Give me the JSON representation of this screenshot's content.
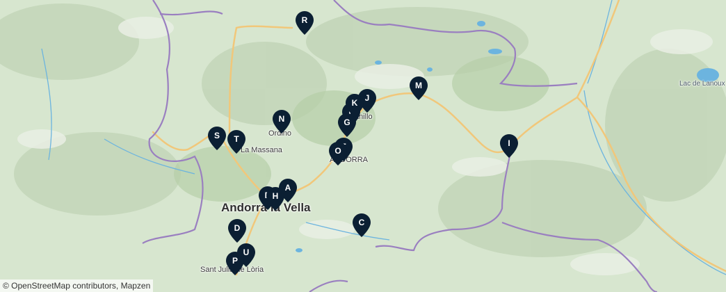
{
  "map": {
    "place_labels": [
      {
        "id": "andorra-la-vella",
        "text": "Andorra la Vella",
        "size": "big"
      },
      {
        "id": "la-massana",
        "text": "La Massana",
        "size": "small"
      },
      {
        "id": "ordino",
        "text": "Ordino",
        "size": "small"
      },
      {
        "id": "encamp",
        "text": "ANDORRA",
        "size": "small"
      },
      {
        "id": "canillo",
        "text": "Canillo",
        "size": "small"
      },
      {
        "id": "sant-julia",
        "text": "Sant Julià de Lòria",
        "size": "small"
      },
      {
        "id": "lac-de-lanoux",
        "text": "Lac de Lanoux",
        "size": "lake"
      }
    ],
    "markers": [
      "R",
      "N",
      "S",
      "T",
      "A",
      "H",
      "B",
      "D",
      "U",
      "P",
      "C",
      "O",
      "E",
      "G",
      "F",
      "K",
      "J",
      "M",
      "I"
    ],
    "marker_color": "#0b1f33",
    "border_color": "#9a7fc0",
    "road_color": "#f1c77a",
    "water_color": "#6cb4df"
  },
  "attribution": "© OpenStreetMap contributors, Mapzen"
}
